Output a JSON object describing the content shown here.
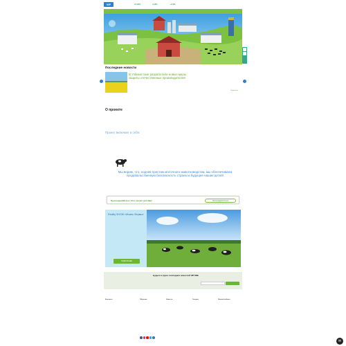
{
  "header": {
    "logo": "VIP",
    "logo_sub": "milk"
  },
  "rates": [
    {
      "value": "+0,19%",
      "label": ""
    },
    {
      "value": "+4,3%",
      "label": ""
    },
    {
      "value": "+2,1%",
      "label": ""
    }
  ],
  "colors": {
    "accent": "#7cc142",
    "link": "#3d8bd2",
    "panel": "#c5e8f7",
    "subscribe_bg": "#e9f0e3"
  },
  "news": {
    "heading": "Последние новости",
    "title": "В Узбекистане разработали новые меры защиты отечественных производителей",
    "text": "",
    "date": "",
    "more": "Подробнее"
  },
  "project": {
    "heading": "О проекте",
    "text": "",
    "includes_heading": "Проект включает в себя:",
    "includes": [
      "",
      "",
      "",
      "",
      "",
      "",
      "",
      "",
      "",
      "",
      "",
      "",
      ""
    ],
    "slogan": "Мы верим, что, подняв престиж молочного животноводства, мы обеспечиваем продовольственную безопасность страны и будущее наших детей!"
  },
  "join": {
    "text": "Присоединяйтесь! Этот проект для Вас!",
    "button": "ПРИСОЕДИНИТЬСЯ"
  },
  "reality": {
    "title": "Reality SHOW «Жизнь Фермы»",
    "text": "",
    "text2": "",
    "author": "",
    "button": "ПОДРОБНЕЕ"
  },
  "subscribe": {
    "title": "Будьте в курсе последних новостей VIP Milk",
    "text": "",
    "placeholder": "",
    "button": ""
  },
  "footer": {
    "col1_title": "Контакты",
    "col2_title": "Обучение",
    "col3_title": "Новости",
    "col4_title": "Галерея",
    "col5_title": "Личный кабинет"
  },
  "icons": [
    "search-icon",
    "arrow-left-icon",
    "arrow-right-icon",
    "cow-icon",
    "chat-icon"
  ]
}
